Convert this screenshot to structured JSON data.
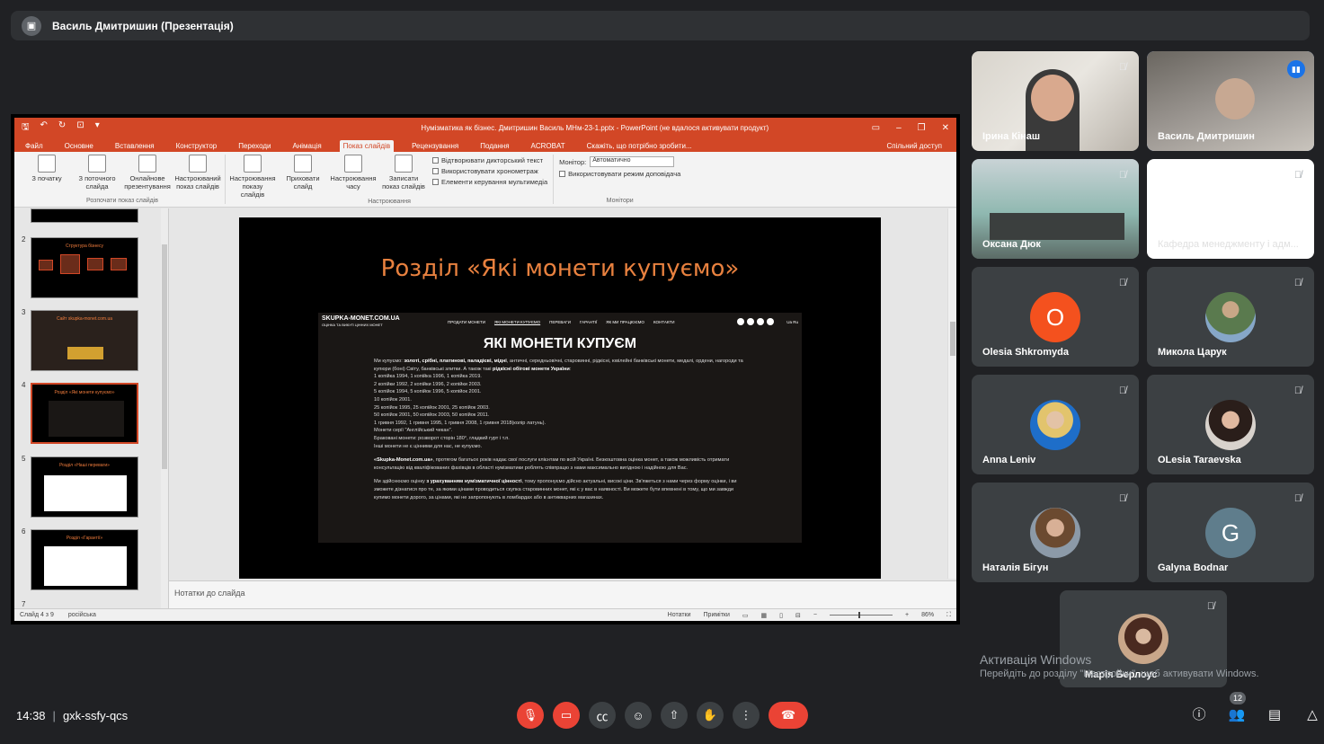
{
  "presenter": {
    "name": "Василь Дмитришин (Презентація)"
  },
  "powerpoint": {
    "doc_title": "Нумізматика як бізнес. Дмитришин Василь МНм-23-1.pptx - PowerPoint (не вдалося активувати продукт)",
    "tabs": [
      "Файл",
      "Основне",
      "Вставлення",
      "Конструктор",
      "Переходи",
      "Анімація",
      "Показ слайдів",
      "Рецензування",
      "Подання",
      "ACROBAT"
    ],
    "active_tab": "Показ слайдів",
    "tell_me": "Скажіть, що потрібно зробити...",
    "share": "Спільний доступ",
    "ribbon": {
      "group1_label": "Розпочати показ слайдів",
      "btn_from_start": "З початку",
      "btn_from_current": "З поточного слайда",
      "btn_online": "Онлайнове презентування",
      "btn_custom": "Настроюваний показ слайдів",
      "group2_label": "Настроювання",
      "btn_setup": "Настроювання показу слайдів",
      "btn_hide": "Приховати слайд",
      "btn_rehearse": "Настроювання часу",
      "btn_record": "Записати показ слайдів",
      "chk_narration": "Відтворювати дикторський текст",
      "chk_timings": "Використовувати хронометраж",
      "chk_media": "Елементи керування мультимедіа",
      "group3_label": "Монітори",
      "monitor_label": "Монітор:",
      "monitor_value": "Автоматично",
      "chk_presenter": "Використовувати режим доповідача"
    },
    "thumbs": [
      {
        "num": "2",
        "title": "Структура бізнесу"
      },
      {
        "num": "3",
        "title": "Сайт skupka-monet.com.ua"
      },
      {
        "num": "4",
        "title": "Розділ «Які монети купуємо»"
      },
      {
        "num": "5",
        "title": "Розділ «Наші переваги»"
      },
      {
        "num": "6",
        "title": "Розділ «Гарантії»"
      },
      {
        "num": "7",
        "title": ""
      }
    ],
    "slide": {
      "title": "Розділ «Які монети купуємо»",
      "site_logo": "SKUPKA-MONET.COM.UA",
      "site_logo_sub": "ОЦІНКА ТА ВИКУП ЦІННИХ МОНЕТ",
      "site_nav": [
        "ПРОДАТИ МОНЕТИ",
        "ЯКІ МОНЕТИ КУПУЄМО",
        "ПЕРЕВАГИ",
        "ГАРАНТІЇ",
        "ЯК МИ ПРАЦЮЄМО",
        "КОНТАКТИ"
      ],
      "site_lang": "Ua   Ru",
      "site_h1": "ЯКІ МОНЕТИ КУПУЄМ",
      "p1_lead": "Ми купуємо: ",
      "p1_bold": "золоті, срібні, платинові, паладієві, мідні",
      "p1_rest": ", античні, середньовічні, старовинні, рідкісні, ювілейні банківські монети, медалі, ордени, нагороди та купюри (боні) Світу, банківські злитки. А також такі ",
      "p1_bold2": "рідкісні обігові монети України",
      "p1_end": ":",
      "lines": [
        "1 копійка 1994, 1 копійка 1996, 1 копійка 2019.",
        "2 копійки 1992, 2 копійки 1996, 2 копійки 2003.",
        "5 копійок 1994, 5 копійок 1996, 5 копійок 2001.",
        "10 копійок 2001.",
        "25 копійок 1995, 25 копійок 2001, 25 копійок 2003.",
        "50 копійок 2001, 50 копійок 2003, 50 копійок 2011.",
        "1 гривня 1992, 1 гривня 1995, 1 гривня 2008, 1 гривня 2018(колір латунь).",
        "Монети серії \"Англійський чекан\".",
        "Браковані монети: розворот сторін 180°, гладкий гурт і т.п.",
        "Інші монети не є цінними для нас, не купуємо."
      ],
      "p2_bold": "«Skupka-Monet.com.ua»",
      "p2_rest": ", протягом багатьох років надає свої послуги клієнтам по всій Україні. Безкоштовна оцінка монет, а також можливість отримати консультацію від кваліфікованих фахівців в області нумізматики роблять співпрацю з нами максимально вигідною і надійною для Вас.",
      "p3_lead": "Ми здійснюємо оцінку ",
      "p3_bold": "з урахуванням нумізматичної цінності",
      "p3_rest": ", тому пропонуємо дійсно актуальні, високі ціни. Зв'яжеться з нами через форму оцінки, і ви зможете дізнатися про те, за якими цінами проводиться скупка старовинних монет, які є у вас в наявності. Ви можете бути впевнені в тому, що ми завжди купимо монети дорого, за цінами, які не запропонують в ломбардах або в антикварних магазинах."
    },
    "notes_placeholder": "Нотатки до слайда",
    "status": {
      "slide_info": "Слайд 4 з 9",
      "language": "російська",
      "notes": "Нотатки",
      "comments": "Примітки",
      "zoom": "86%"
    }
  },
  "participants": [
    {
      "name": "Ірина Кінаш",
      "type": "video",
      "muted": true
    },
    {
      "name": "Василь Дмитришин",
      "type": "video",
      "muted": false,
      "speaking": true
    },
    {
      "name": "Оксана Дюк",
      "type": "video",
      "muted": true
    },
    {
      "name": "Кафедра менеджменту і адм...",
      "type": "blank",
      "muted": true
    },
    {
      "name": "Olesia Shkromyda",
      "type": "letter",
      "letter": "O",
      "color": "#f4511e",
      "muted": true
    },
    {
      "name": "Микола Царук",
      "type": "photo",
      "muted": true
    },
    {
      "name": "Anna Leniv",
      "type": "photo",
      "muted": true
    },
    {
      "name": "OLesia Taraevska",
      "type": "photo",
      "muted": true
    },
    {
      "name": "Наталія Бігун",
      "type": "photo",
      "muted": true
    },
    {
      "name": "Galyna Bodnar",
      "type": "letter",
      "letter": "G",
      "color": "#5f7d8c",
      "muted": true
    },
    {
      "name": "Марія Берлоус",
      "type": "photo",
      "muted": true
    }
  ],
  "watermark": {
    "title": "Активація Windows",
    "sub": "Перейдіть до розділу \"Настройки\", щоб активувати Windows."
  },
  "meeting": {
    "time": "14:38",
    "code": "gxk-ssfy-qcs",
    "people_count": "12"
  },
  "colors": {
    "ppt_accent": "#d24726",
    "meet_red": "#ea4335",
    "slide_title": "#e8813f"
  }
}
